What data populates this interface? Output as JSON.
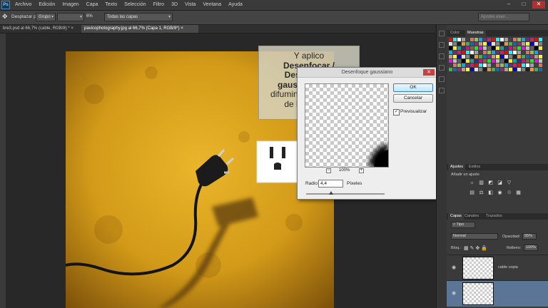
{
  "app": {
    "logo": "Ps"
  },
  "menu": [
    "Archivo",
    "Edición",
    "Imagen",
    "Capa",
    "Texto",
    "Selección",
    "Filtro",
    "3D",
    "Vista",
    "Ventana",
    "Ayuda"
  ],
  "window_buttons": {
    "minimize": "–",
    "maximize": "□",
    "close": "✕"
  },
  "options_bar": {
    "label": "Desplazar por:",
    "group_value": "Grupo",
    "zoom_value": "6%",
    "layers_value": "Todas las capas",
    "search_placeholder": "Ajustes esen..."
  },
  "doc_tabs": [
    {
      "label": "bre3.psd al 66,7% (cable, RGB/8) *",
      "close": "×"
    },
    {
      "label": "pavicophotography.jpg al 66,7% (Capa 1, RGB/8*)",
      "close": "×"
    }
  ],
  "tooltip": {
    "line1": "Y aplico",
    "line2": "Desenfocar /",
    "line3": "Desenfoque",
    "line4": "gaussiano para",
    "line5": "difuminar los bordes",
    "line6": "de la sombra"
  },
  "dialog": {
    "title": "Desenfoque gaussiano",
    "ok": "OK",
    "cancel": "Cancelar",
    "preview_label": "Previsualizar",
    "preview_checked": "✓",
    "zoom_level": "100%",
    "zoom_out": "−",
    "zoom_in": "+",
    "radius_label": "Radio:",
    "radius_value": "4,4",
    "radius_unit": "Píxeles",
    "radius_slider_fraction": 0.32
  },
  "color_panel": {
    "tabs": [
      "Color",
      "Muestras"
    ]
  },
  "adjust_panel": {
    "tabs": [
      "Ajustes",
      "Estilos"
    ],
    "heading": "Añadir un ajuste"
  },
  "layers_panel": {
    "tabs": [
      "Capas",
      "Canales",
      "Trazados"
    ],
    "filter": "Tipo",
    "blend_mode": "Normal",
    "opacity_label": "Opacidad:",
    "opacity_value": "55%",
    "lock_label": "Bloq.:",
    "fill_label": "Relleno:",
    "fill_value": "100%",
    "layers": [
      {
        "name": "cable copia",
        "visible": true,
        "selected": false
      },
      {
        "name": "",
        "visible": true,
        "selected": true
      }
    ]
  },
  "colors": {
    "photo_yellow": "#d9a51c",
    "photo_dark": "#8a5a0c",
    "ok_blue": "#bee6fd",
    "layer_selected": "#5a7596"
  }
}
